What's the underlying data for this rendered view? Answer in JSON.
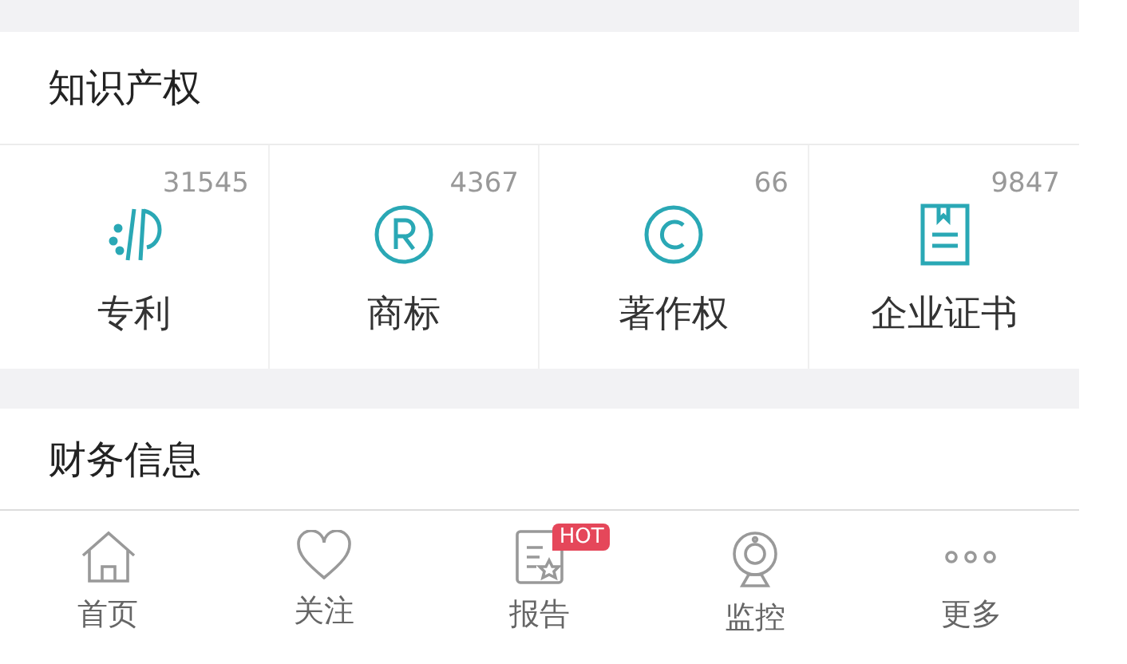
{
  "ip_section": {
    "title": "知识产权",
    "items": [
      {
        "kind": "patent",
        "label": "专利",
        "count": "31545"
      },
      {
        "kind": "trademark",
        "label": "商标",
        "count": "4367"
      },
      {
        "kind": "copyright",
        "label": "著作权",
        "count": "66"
      },
      {
        "kind": "certificate",
        "label": "企业证书",
        "count": "9847"
      }
    ]
  },
  "finance_section": {
    "title": "财务信息"
  },
  "tab_bar": [
    {
      "kind": "home",
      "label": "首页"
    },
    {
      "kind": "heart",
      "label": "关注"
    },
    {
      "kind": "report",
      "label": "报告",
      "badge": "HOT"
    },
    {
      "kind": "monitor",
      "label": "监控"
    },
    {
      "kind": "more",
      "label": "更多"
    }
  ]
}
